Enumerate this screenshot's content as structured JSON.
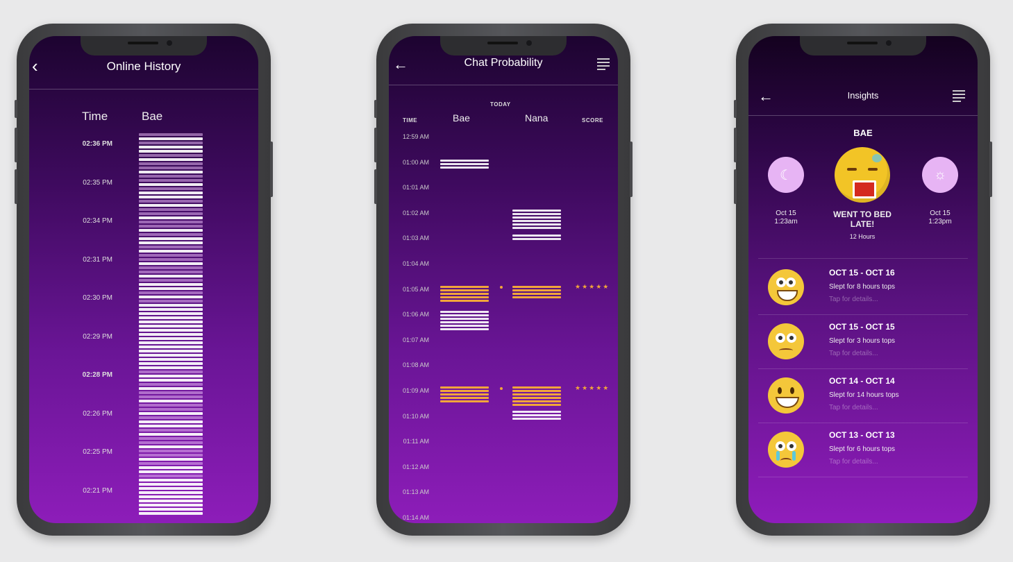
{
  "phone1": {
    "title": "Online History",
    "col_time": "Time",
    "col_name": "Bae",
    "times": [
      "02:36 PM",
      "02:35 PM",
      "02:34 PM",
      "02:31 PM",
      "02:30 PM",
      "02:29 PM",
      "02:28 PM",
      "02:26 PM",
      "02:25 PM",
      "02:21 PM"
    ]
  },
  "phone2": {
    "title": "Chat Probability",
    "today": "TODAY",
    "time_head": "TIME",
    "name1": "Bae",
    "name2": "Nana",
    "score_head": "SCORE",
    "times": [
      "12:59 AM",
      "01:00 AM",
      "01:01 AM",
      "01:02 AM",
      "01:03 AM",
      "01:04 AM",
      "01:05 AM",
      "01:06 AM",
      "01:07 AM",
      "01:08 AM",
      "01:09 AM",
      "01:10 AM",
      "01:11 AM",
      "01:12 AM",
      "01:13 AM",
      "01:14 AM"
    ],
    "score1": "★★★★★",
    "score2": "★★★★★"
  },
  "phone3": {
    "title": "Insights",
    "name": "BAE",
    "left_date": "Oct 15",
    "left_time": "1:23am",
    "right_date": "Oct 15",
    "right_time": "1:23pm",
    "headline1": "WENT TO BED",
    "headline2": "LATE!",
    "hours": "12 Hours",
    "rows": [
      {
        "title": "OCT 15 - OCT 16",
        "sub": "Slept for 8 hours tops",
        "tap": "Tap for details..."
      },
      {
        "title": "OCT 15 - OCT 15",
        "sub": "Slept for 3 hours tops",
        "tap": "Tap for details..."
      },
      {
        "title": "OCT 14 - OCT 14",
        "sub": "Slept for 14 hours tops",
        "tap": "Tap for details..."
      },
      {
        "title": "OCT 13 - OCT 13",
        "sub": "Slept for 6 hours tops",
        "tap": "Tap for details..."
      }
    ]
  },
  "colors": {
    "accent": "#f2a53a",
    "bar": "#ffffff",
    "bg_top": "#1d0430",
    "bg_bottom": "#8d1db9"
  }
}
